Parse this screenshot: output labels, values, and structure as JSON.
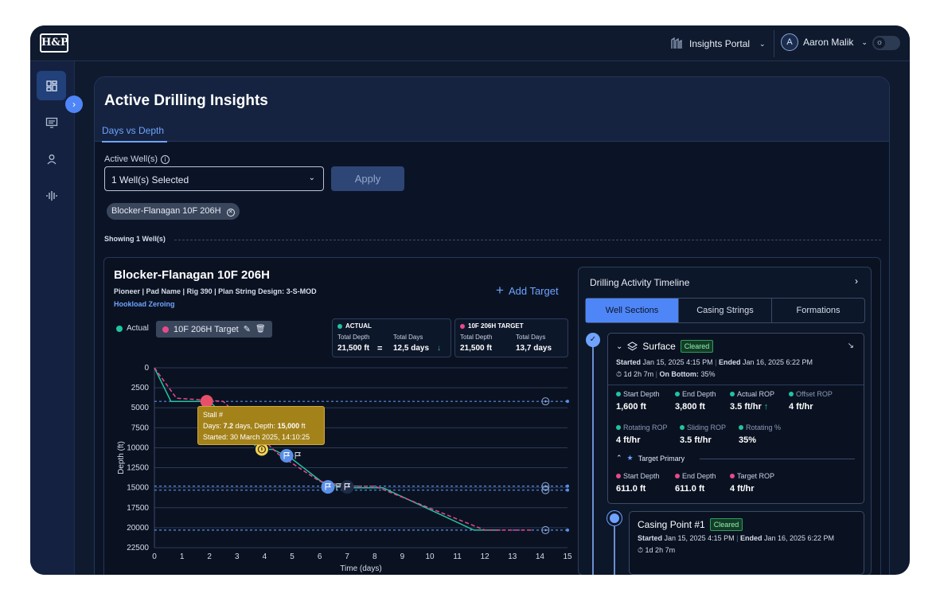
{
  "brand": {
    "logo_text": "H&P"
  },
  "header": {
    "portal_label": "Insights Portal",
    "user_initial": "A",
    "user_name": "Aaron Malik"
  },
  "page": {
    "title": "Active Drilling Insights",
    "tab": "Days vs Depth",
    "wells_label": "Active Well(s)",
    "wells_value": "1 Well(s) Selected",
    "apply_label": "Apply",
    "chip": "Blocker-Flanagan 10F 206H",
    "showing": "Showing  1 Well(s)"
  },
  "well": {
    "name": "Blocker-Flanagan 10F 206H",
    "meta": "Pioneer  |  Pad Name  |  Rig 390  |  Plan String Design: 3-S-MOD",
    "hookload": "Hookload Zeroing",
    "add_target": "Add Target",
    "legend_actual": "Actual",
    "legend_target": "10F 206H Target"
  },
  "stats": {
    "actual": {
      "header": "ACTUAL",
      "depth_label": "Total Depth",
      "depth_value": "21,500 ft",
      "days_label": "Total Days",
      "days_value": "12,5 days"
    },
    "target": {
      "header": "10F 206H TARGET",
      "depth_label": "Total Depth",
      "depth_value": "21,500 ft",
      "days_label": "Total Days",
      "days_value": "13,7 days"
    }
  },
  "tooltip": {
    "title": "Stall #",
    "line1_pre": "Days: ",
    "days": "7.2",
    "line1_mid": " days, Depth: ",
    "depth": "15,000",
    "line1_post": " ft",
    "line2": "Started: 30 March 2025, 14:10:25"
  },
  "chart_data": {
    "type": "line",
    "xlabel": "Time (days)",
    "ylabel": "Depth (ft)",
    "xlim": [
      0,
      15
    ],
    "ylim": [
      22500,
      0
    ],
    "x_ticks": [
      0,
      1,
      2,
      3,
      4,
      5,
      6,
      7,
      8,
      9,
      10,
      11,
      12,
      13,
      14,
      15
    ],
    "y_ticks": [
      0,
      2500,
      5000,
      7500,
      10000,
      12500,
      15000,
      17500,
      20000,
      22500
    ],
    "y_tick_labels": [
      "0",
      "2500",
      "5000",
      "7500",
      "10000",
      "12500",
      "15000",
      "17500",
      "20000",
      "22500"
    ],
    "series": [
      {
        "name": "Actual",
        "color": "#22c3a0",
        "style": "solid",
        "x": [
          0,
          0.6,
          2.0,
          3.8,
          4.3,
          5.0,
          6.2,
          7.2,
          8.3,
          11.6,
          12.5
        ],
        "y": [
          0,
          4200,
          4200,
          10200,
          10200,
          11400,
          14600,
          15000,
          15000,
          20300,
          20300
        ]
      },
      {
        "name": "10F 206H Target",
        "color": "#e84a8a",
        "style": "dashed",
        "x": [
          0,
          0.8,
          2.5,
          4.5,
          6.0,
          7.0,
          8.0,
          12.0,
          13.7
        ],
        "y": [
          0,
          3800,
          4200,
          10800,
          14200,
          14800,
          14800,
          20300,
          20300
        ]
      }
    ],
    "reference_lines": [
      4200,
      14800,
      15300,
      20300
    ],
    "markers": [
      {
        "x": 1.9,
        "y": 4200,
        "kind": "red"
      },
      {
        "x": 3.9,
        "y": 10200,
        "kind": "stall"
      },
      {
        "x": 4.8,
        "y": 11000,
        "kind": "flag"
      },
      {
        "x": 6.3,
        "y": 14900,
        "kind": "flag"
      },
      {
        "x": 7.0,
        "y": 14900,
        "kind": "flag-dark"
      }
    ]
  },
  "timeline": {
    "title": "Drilling Activity Timeline",
    "tabs": [
      "Well Sections",
      "Casing Strings",
      "Formations"
    ],
    "section1": {
      "name": "Surface",
      "status": "Cleared",
      "started_label": "Started",
      "started": "Jan 15, 2025 4:15 PM",
      "ended_label": "Ended",
      "ended": "Jan 16, 2025 6:22 PM",
      "duration": "1d 2h 7m",
      "on_bottom_label": "On Bottom:",
      "on_bottom": "35%",
      "metrics": [
        {
          "label": "Start Depth",
          "value": "1,600 ft"
        },
        {
          "label": "End Depth",
          "value": "3,800 ft"
        },
        {
          "label": "Actual ROP",
          "value": "3.5 ft/hr"
        },
        {
          "label": "Offset ROP",
          "value": "4 ft/hr"
        },
        {
          "label": "Rotating ROP",
          "value": "4 ft/hr"
        },
        {
          "label": "Sliding ROP",
          "value": "3.5 ft/hr"
        },
        {
          "label": "Rotating %",
          "value": "35%"
        }
      ],
      "target_label": "Target Primary",
      "target_metrics": [
        {
          "label": "Start Depth",
          "value": "611.0 ft"
        },
        {
          "label": "End Depth",
          "value": "611.0 ft"
        },
        {
          "label": "Target ROP",
          "value": "4 ft/hr"
        }
      ]
    },
    "section2": {
      "name": "Casing Point #1",
      "status": "Cleared",
      "started_label": "Started",
      "started": "Jan 15, 2025 4:15 PM",
      "ended_label": "Ended",
      "ended": "Jan 16, 2025 6:22 PM",
      "duration": "1d 2h 7m"
    }
  },
  "colors": {
    "accent": "#4f86f7",
    "actual": "#22c3a0",
    "target": "#e84a8a",
    "cleared": "#2e9d5e"
  }
}
